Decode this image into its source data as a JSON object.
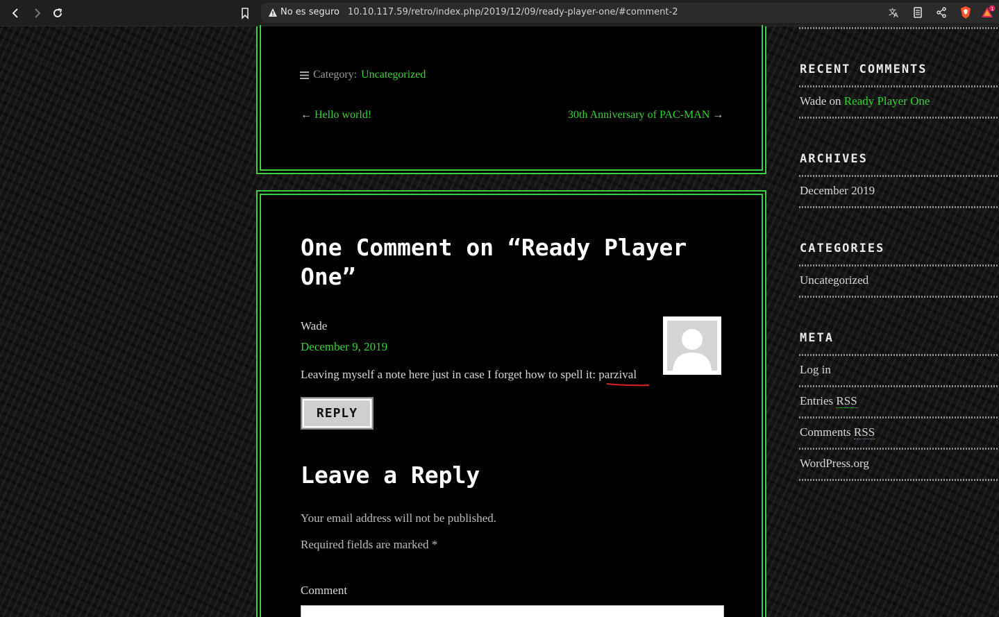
{
  "browser": {
    "security_label": "No es seguro",
    "url": "10.10.117.59/retro/index.php/2019/12/09/ready-player-one/#comment-2",
    "notification_count": "1"
  },
  "post_meta": {
    "category_label": "Category:",
    "category": "Uncategorized"
  },
  "post_nav": {
    "prev_arrow": "←",
    "prev": "Hello world!",
    "next": "30th Anniversary of PAC-MAN",
    "next_arrow": "→"
  },
  "comments": {
    "title": "One Comment on “Ready Player One”",
    "items": [
      {
        "author": "Wade",
        "date": "December 9, 2019",
        "text_prefix": "Leaving myself a note here just in case I forget how to spell it: ",
        "text_highlight": "parzival",
        "reply_label": "REPLY"
      }
    ]
  },
  "reply_form": {
    "title": "Leave a Reply",
    "notice": "Your email address will not be published.",
    "required": "Required fields are marked *",
    "comment_label": "Comment"
  },
  "sidebar": {
    "recent_comments": {
      "title": "RECENT COMMENTS",
      "author": "Wade",
      "on": " on ",
      "post": "Ready Player One"
    },
    "archives": {
      "title": "ARCHIVES",
      "items": [
        "December 2019"
      ]
    },
    "categories": {
      "title": "CATEGORIES",
      "items": [
        "Uncategorized"
      ]
    },
    "meta": {
      "title": "META",
      "login": "Log in",
      "entries": "Entries ",
      "comments": "Comments ",
      "rss": "RSS",
      "wordpress": "WordPress.org"
    }
  },
  "colors": {
    "accent": "#33d633",
    "border": "#3bd33b",
    "background": "#000000"
  }
}
